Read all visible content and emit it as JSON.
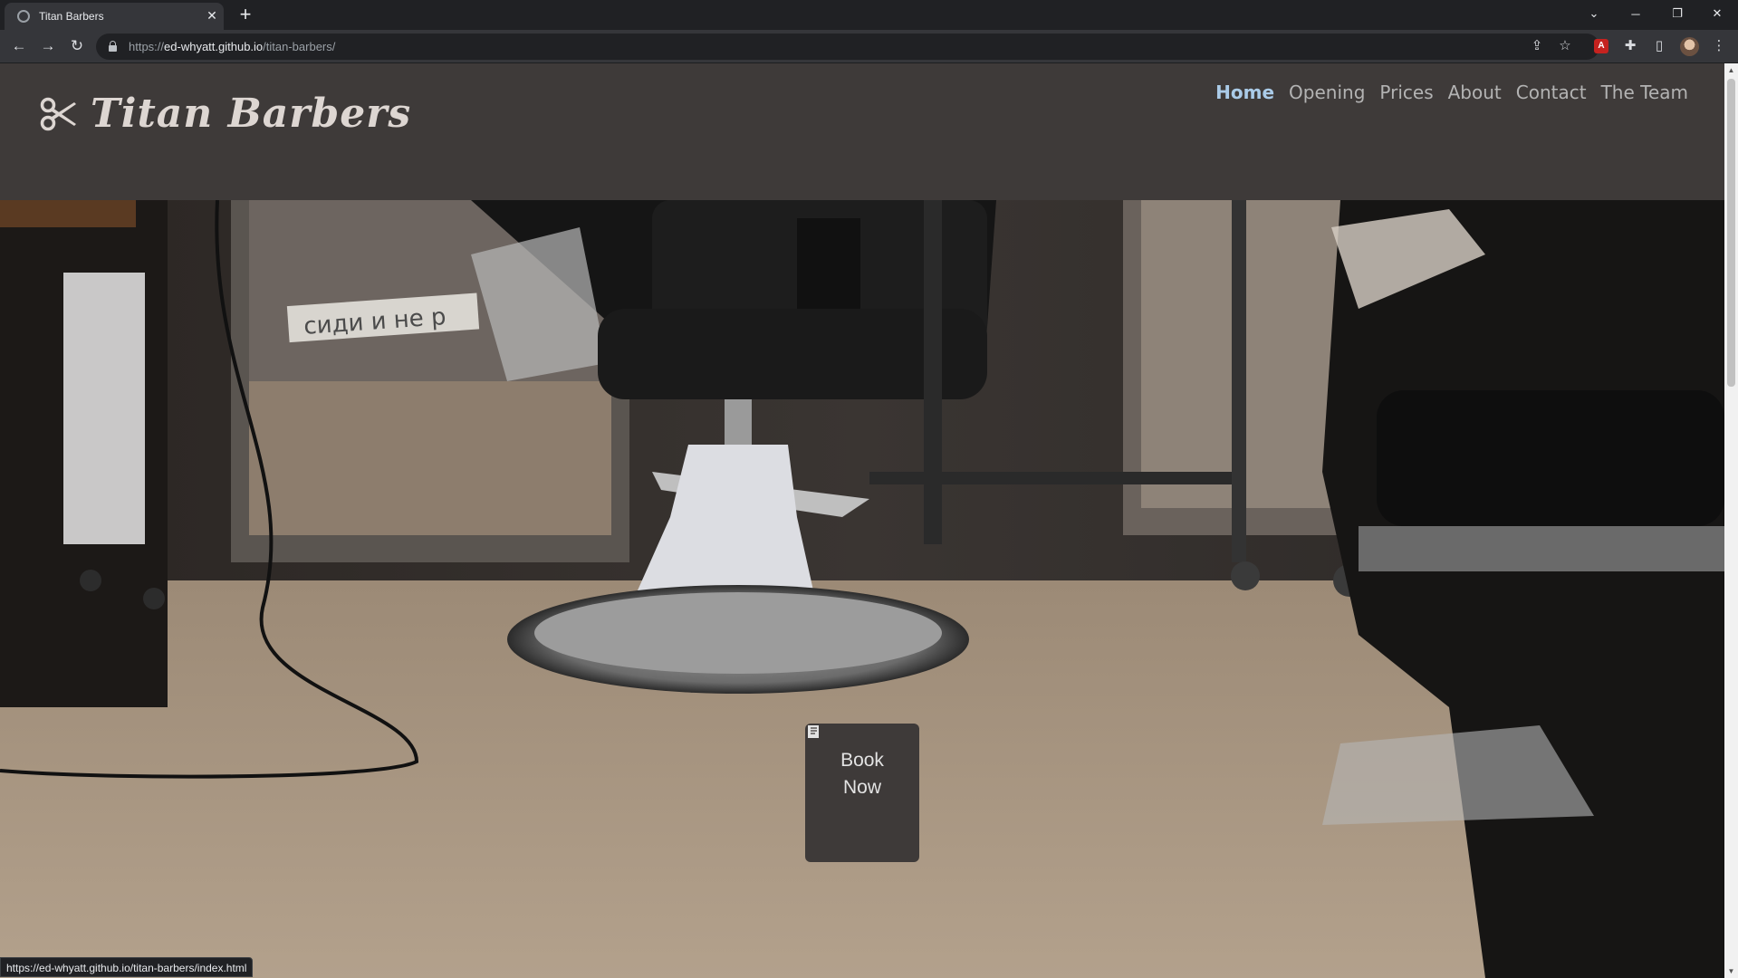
{
  "browser": {
    "tab_title": "Titan Barbers",
    "new_tab_symbol": "+",
    "url_scheme": "https://",
    "url_host": "ed-whyatt.github.io",
    "url_path": "/titan-barbers/",
    "status_url": "https://ed-whyatt.github.io/titan-barbers/index.html"
  },
  "site": {
    "logo_text": "Titan Barbers",
    "nav": [
      {
        "label": "Home"
      },
      {
        "label": "Opening"
      },
      {
        "label": "Prices"
      },
      {
        "label": "About"
      },
      {
        "label": "Contact"
      },
      {
        "label": "The Team"
      }
    ],
    "active_nav": "Home",
    "hero_sign_text": "сиди и не р",
    "book_button": {
      "line1": "Book",
      "line2": "Now"
    }
  },
  "colors": {
    "header_bg": "#3e3a39",
    "nav_text": "#b3b3b3",
    "nav_active": "#aacbe8",
    "logo_text": "#ddd6d2"
  }
}
